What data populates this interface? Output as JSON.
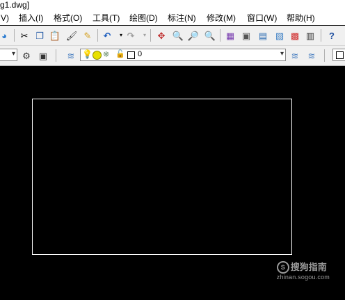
{
  "window": {
    "title": "g1.dwg]"
  },
  "menubar": {
    "items": [
      {
        "label": "V)"
      },
      {
        "label": "插入(I)"
      },
      {
        "label": "格式(O)"
      },
      {
        "label": "工具(T)"
      },
      {
        "label": "绘图(D)"
      },
      {
        "label": "标注(N)"
      },
      {
        "label": "修改(M)"
      },
      {
        "label": "窗口(W)"
      },
      {
        "label": "帮助(H)"
      }
    ]
  },
  "toolbar2": {
    "layer_value": "0"
  },
  "watermark": {
    "main": "搜狗指南",
    "sub": "zhinan.sogou.com"
  }
}
